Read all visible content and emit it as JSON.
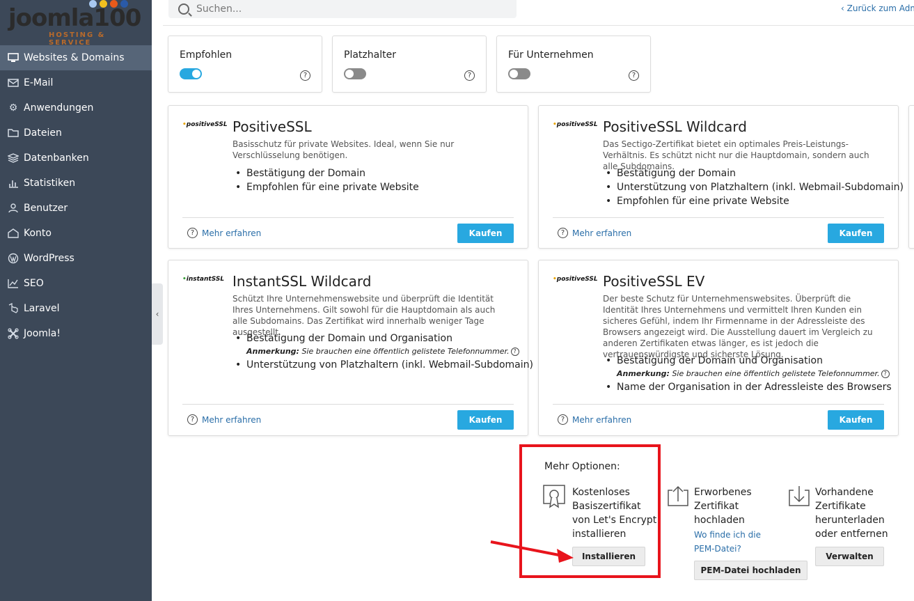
{
  "brand": {
    "logo_text": "joomla",
    "logo_number": "100",
    "logo_tagline": "HOSTING & SERVICE",
    "dot_colors": [
      "#a8c8f0",
      "#f0c020",
      "#e85a1a",
      "#2a5aa8"
    ]
  },
  "sidebar": {
    "items": [
      {
        "label": "Websites & Domains",
        "icon": "monitor-icon",
        "active": true
      },
      {
        "label": "E-Mail",
        "icon": "envelope-icon"
      },
      {
        "label": "Anwendungen",
        "icon": "gear-icon"
      },
      {
        "label": "Dateien",
        "icon": "folder-icon"
      },
      {
        "label": "Datenbanken",
        "icon": "database-icon"
      },
      {
        "label": "Statistiken",
        "icon": "bar-chart-icon"
      },
      {
        "label": "Benutzer",
        "icon": "user-icon"
      },
      {
        "label": "Konto",
        "icon": "account-icon"
      },
      {
        "label": "WordPress",
        "icon": "wordpress-icon"
      },
      {
        "label": "SEO",
        "icon": "seo-chart-icon"
      },
      {
        "label": "Laravel",
        "icon": "laravel-icon"
      },
      {
        "label": "Joomla!",
        "icon": "joomla-icon"
      }
    ]
  },
  "topbar": {
    "search_placeholder": "Suchen...",
    "back_link": "Zurück zum Adm"
  },
  "filters": [
    {
      "label": "Empfohlen",
      "on": true
    },
    {
      "label": "Platzhalter",
      "on": false
    },
    {
      "label": "Für Unternehmen",
      "on": false
    }
  ],
  "cards": [
    {
      "brand": "positiveSSL",
      "title": "PositiveSSL",
      "desc": "Basisschutz für private Websites. Ideal, wenn Sie nur Verschlüsselung benötigen.",
      "features": [
        "Bestätigung der Domain",
        "Empfohlen für eine private Website"
      ],
      "more": "Mehr erfahren",
      "buy": "Kaufen"
    },
    {
      "brand": "positiveSSL",
      "title": "PositiveSSL Wildcard",
      "desc": "Das Sectigo-Zertifikat bietet ein optimales Preis-Leistungs-Verhältnis. Es schützt nicht nur die Hauptdomain, sondern auch alle Subdomains.",
      "features": [
        "Bestätigung der Domain",
        "Unterstützung von Platzhaltern (inkl. Webmail-Subdomain)",
        "Empfohlen für eine private Website"
      ],
      "more": "Mehr erfahren",
      "buy": "Kaufen"
    },
    {
      "brand": "instantSSL",
      "title": "InstantSSL Wildcard",
      "desc": "Schützt Ihre Unternehmenswebsite und überprüft die Identität Ihres Unternehmens. Gilt sowohl für die Hauptdomain als auch alle Subdomains. Das Zertifikat wird innerhalb weniger Tage ausgestellt.",
      "features": [
        "Bestätigung der Domain und Organisation",
        "Unterstützung von Platzhaltern (inkl. Webmail-Subdomain)"
      ],
      "note_label": "Anmerkung:",
      "note_text": "Sie brauchen eine öffentlich gelistete Telefonnummer.",
      "more": "Mehr erfahren",
      "buy": "Kaufen"
    },
    {
      "brand": "positiveSSL",
      "title": "PositiveSSL EV",
      "desc": "Der beste Schutz für Unternehmenswebsites. Überprüft die Identität Ihres Unternehmens und vermittelt Ihren Kunden ein sicheres Gefühl, indem Ihr Firmenname in der Adressleiste des Browsers angezeigt wird. Die Ausstellung dauert im Vergleich zu anderen Zertifikaten etwas länger, es ist jedoch die vertrauenswürdigste und sicherste Lösung.",
      "features": [
        "Bestätigung der Domain und Organisation",
        "Name der Organisation in der Adressleiste des Browsers"
      ],
      "note_label": "Anmerkung:",
      "note_text": "Sie brauchen eine öffentlich gelistete Telefonnummer.",
      "more": "Mehr erfahren",
      "buy": "Kaufen"
    }
  ],
  "more_options": {
    "title": "Mehr Optionen:",
    "letsencrypt": {
      "text": "Kostenloses Basiszertifikat von Let's Encrypt installieren",
      "lines": [
        "Kostenloses",
        "Basiszertifikat",
        "von Let's Encrypt",
        "installieren"
      ],
      "button": "Installieren"
    },
    "upload": {
      "lines": [
        "Erworbenes",
        "Zertifikat",
        "hochladen"
      ],
      "link_lines": [
        "Wo finde ich die",
        "PEM-Datei?"
      ],
      "button": "PEM-Datei hochladen"
    },
    "manage": {
      "lines": [
        "Vorhandene",
        "Zertifikate",
        "herunterladen",
        "oder entfernen"
      ],
      "button": "Verwalten"
    }
  },
  "colors": {
    "sidebar_bg": "#3c4858",
    "sidebar_active": "#566578",
    "accent": "#28a8e0",
    "link": "#2a6ea8",
    "highlight": "#e8141c"
  }
}
